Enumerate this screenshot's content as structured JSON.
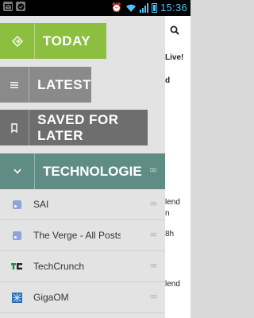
{
  "status_bar": {
    "time": "15:36",
    "left_icons": [
      "mail-icon",
      "check-icon"
    ],
    "right_icons": [
      "alarm-icon",
      "wifi-icon",
      "signal-icon",
      "battery-icon"
    ]
  },
  "background": {
    "snippets": [
      "Live!",
      "d",
      "lend",
      "n",
      "8h",
      "lend"
    ]
  },
  "drawer": {
    "today": "TODAY",
    "latest": "LATEST",
    "saved": "SAVED FOR LATER",
    "category": {
      "label": "TECHNOLOGIE",
      "count": "∞"
    },
    "feeds": [
      {
        "name": "SAI",
        "count": "∞",
        "icon": "rss-icon"
      },
      {
        "name": "The Verge - All Posts",
        "count": "∞",
        "icon": "rss-icon"
      },
      {
        "name": "TechCrunch",
        "count": "∞",
        "icon": "techcrunch-icon"
      },
      {
        "name": "GigaOM",
        "count": "∞",
        "icon": "gigaom-icon"
      }
    ]
  },
  "colors": {
    "today": "#8cbf3f",
    "latest": "#8a8a8a",
    "saved": "#6e6e6e",
    "category": "#5f8c85",
    "clock": "#4fc3f7"
  }
}
